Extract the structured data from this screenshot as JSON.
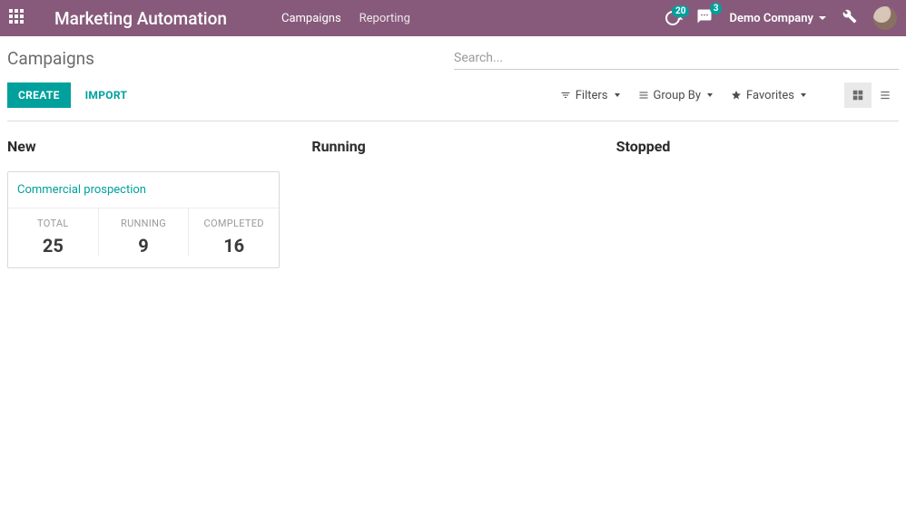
{
  "header": {
    "brand": "Marketing Automation",
    "nav": {
      "campaigns": "Campaigns",
      "reporting": "Reporting"
    },
    "timer_badge": "20",
    "chat_badge": "3",
    "company": "Demo Company"
  },
  "control": {
    "breadcrumb": "Campaigns",
    "search_placeholder": "Search...",
    "create": "CREATE",
    "import": "IMPORT",
    "filters": "Filters",
    "groupby": "Group By",
    "favorites": "Favorites"
  },
  "kanban": {
    "columns": {
      "new": "New",
      "running": "Running",
      "stopped": "Stopped"
    },
    "card": {
      "title": "Commercial prospection",
      "total_label": "TOTAL",
      "total": "25",
      "running_label": "RUNNING",
      "running": "9",
      "completed_label": "COMPLETED",
      "completed": "16"
    }
  },
  "colors": {
    "accent": "#00A09D",
    "brand_bg": "#875A7B"
  }
}
